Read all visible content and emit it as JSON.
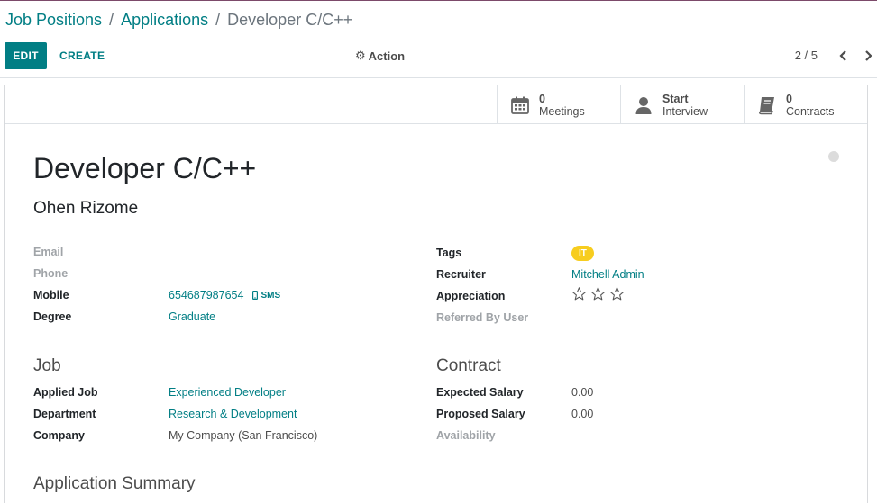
{
  "breadcrumb": {
    "items": [
      "Job Positions",
      "Applications"
    ],
    "separator": "/",
    "current": "Developer C/C++"
  },
  "toolbar": {
    "edit_label": "EDIT",
    "create_label": "CREATE",
    "action_label": "Action",
    "action_icon": "gear-icon",
    "pager_value": "2 / 5"
  },
  "smart_buttons": {
    "meetings": {
      "value": "0",
      "label": "Meetings",
      "icon": "calendar-icon"
    },
    "interview": {
      "value": "Start",
      "label": "Interview",
      "icon": "user-icon"
    },
    "contracts": {
      "value": "0",
      "label": "Contracts",
      "icon": "book-icon"
    }
  },
  "record": {
    "title": "Developer C/C++",
    "partner_name": "Ohen Rizome"
  },
  "left_fields": {
    "email_label": "Email",
    "phone_label": "Phone",
    "mobile_label": "Mobile",
    "mobile_value": "654687987654",
    "sms_label": "SMS",
    "degree_label": "Degree",
    "degree_value": "Graduate"
  },
  "right_fields": {
    "tags_label": "Tags",
    "tag_value": "IT",
    "recruiter_label": "Recruiter",
    "recruiter_value": "Mitchell Admin",
    "appreciation_label": "Appreciation",
    "appreciation_stars": 0,
    "referred_label": "Referred By User"
  },
  "job_section": {
    "title": "Job",
    "applied_job_label": "Applied Job",
    "applied_job_value": "Experienced Developer",
    "department_label": "Department",
    "department_value": "Research & Development",
    "company_label": "Company",
    "company_value": "My Company (San Francisco)"
  },
  "contract_section": {
    "title": "Contract",
    "expected_label": "Expected Salary",
    "expected_value": "0.00",
    "proposed_label": "Proposed Salary",
    "proposed_value": "0.00",
    "availability_label": "Availability"
  },
  "summary": {
    "title": "Application Summary"
  },
  "colors": {
    "primary": "#017e84",
    "tag_yellow": "#f7cd1f",
    "muted_label": "#a0a4a8"
  }
}
